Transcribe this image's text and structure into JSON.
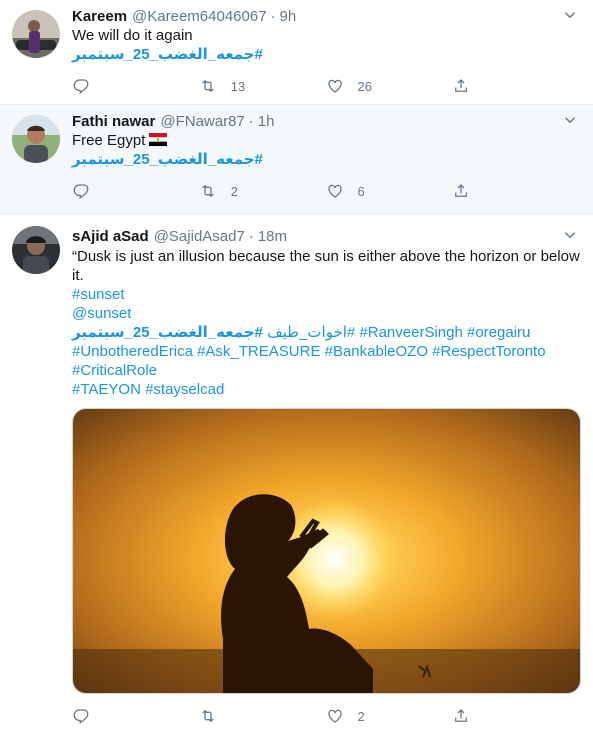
{
  "tweets": [
    {
      "name": "Kareem",
      "handle": "@Kareem64046067",
      "time": "9h",
      "lines": [
        "We will do it again"
      ],
      "hashtag": "#جمعه_الغضب_25_سبتمبر",
      "counts": {
        "reply": "",
        "retweet": "13",
        "like": "26"
      }
    },
    {
      "name": "Fathi nawar",
      "handle": "@FNawar87",
      "time": "1h",
      "text": "Free Egypt",
      "flag_icon": "egypt-flag-icon",
      "hashtag": "#جمعه_الغضب_25_سبتمبر",
      "counts": {
        "reply": "",
        "retweet": "2",
        "like": "6"
      }
    },
    {
      "name": "sAjid aSad",
      "handle": "@SajidAsad7",
      "time": "18m",
      "text_line1": "“Dusk is just an illusion because the sun is either above the horizon or below",
      "text_line2": "it.",
      "link_sunset": "#sunset",
      "mention_sunset": "@sunset",
      "tags_line": {
        "t1": "#جمعه_الغضب_25_سبتمبر",
        "t2": "#اخوات_طيف",
        "t3": "#RanveerSingh",
        "t4": "#oregairu"
      },
      "tags_line2": "#UnbotheredErica #Ask_TREASURE #BankableOZO #RespectToronto",
      "tags_line3": "#CriticalRole",
      "tags_line4": "#TAEYON #stayselcad",
      "media_alt": "sunset-silhouette-photo",
      "counts": {
        "reply": "",
        "retweet": "",
        "like": "2"
      }
    }
  ],
  "colors": {
    "link": "#1b95e0",
    "muted": "#657786",
    "highlight_bg": "#f5f8fa"
  }
}
